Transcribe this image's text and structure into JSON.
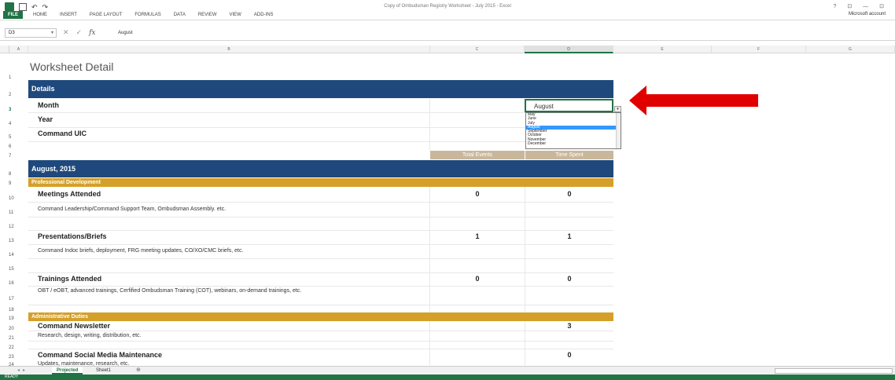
{
  "app": {
    "doc_title": "Copy of Ombudsman Registry Worksheet - July 2015 - Excel",
    "account": "Microsoft account",
    "ribbon_tabs": [
      "FILE",
      "HOME",
      "INSERT",
      "PAGE LAYOUT",
      "FORMULAS",
      "DATA",
      "REVIEW",
      "VIEW",
      "ADD-INS"
    ],
    "window_controls": "? ⊡ — ⊡"
  },
  "formula_bar": {
    "name_box": "D3",
    "value": "August"
  },
  "columns": [
    "A",
    "B",
    "C",
    "D",
    "E",
    "F",
    "G"
  ],
  "rows": [
    "1",
    "2",
    "3",
    "4",
    "5",
    "6",
    "7",
    "8",
    "9",
    "10",
    "11",
    "12",
    "13",
    "14",
    "15",
    "16",
    "17",
    "18",
    "19",
    "20",
    "21",
    "22",
    "23",
    "24"
  ],
  "sheet": {
    "title": "Worksheet Detail",
    "details_header": "Details",
    "month_label": "Month",
    "month_value": "August",
    "year_label": "Year",
    "uic_label": "Command UIC",
    "col_total_events": "Total Events",
    "col_time_spent": "Time Spent",
    "period_header": "August, 2015",
    "section_prof": "Professional Development",
    "meetings_label": "Meetings Attended",
    "meetings_desc": "Command Leadership/Command Support Team, Ombudsman Assembly. etc.",
    "meetings_events": "0",
    "meetings_time": "0",
    "pres_label": "Presentations/Briefs",
    "pres_desc": "Command Indoc briefs, deployment, FRG meeting updates, CO/XO/CMC briefs, etc.",
    "pres_events": "1",
    "pres_time": "1",
    "train_label": "Trainings Attended",
    "train_desc": "OBT / eOBT, advanced trainings, Cerfified Ombudsman Training (COT), webinars, on-demand trainings, etc.",
    "train_events": "0",
    "train_time": "0",
    "section_admin": "Administrative Duties",
    "news_label": "Command Newsletter",
    "news_desc": "Research, design, writing, distribution, etc.",
    "news_time": "3",
    "social_label": "Command Social Media Maintenance",
    "social_desc": "Updates, maintenance, research, etc.",
    "social_time": "0"
  },
  "month_dropdown": {
    "options": [
      "May",
      "June",
      "July",
      "August",
      "September",
      "October",
      "November",
      "December"
    ],
    "selected": "August"
  },
  "sheet_tabs": {
    "tabs": [
      "Projected",
      "Sheet1"
    ],
    "active": "Projected"
  },
  "status": {
    "text": "READY"
  },
  "colors": {
    "accent": "#217346",
    "band_blue": "#1f497d",
    "band_gold": "#d4a02a",
    "arrow": "#e00000"
  }
}
